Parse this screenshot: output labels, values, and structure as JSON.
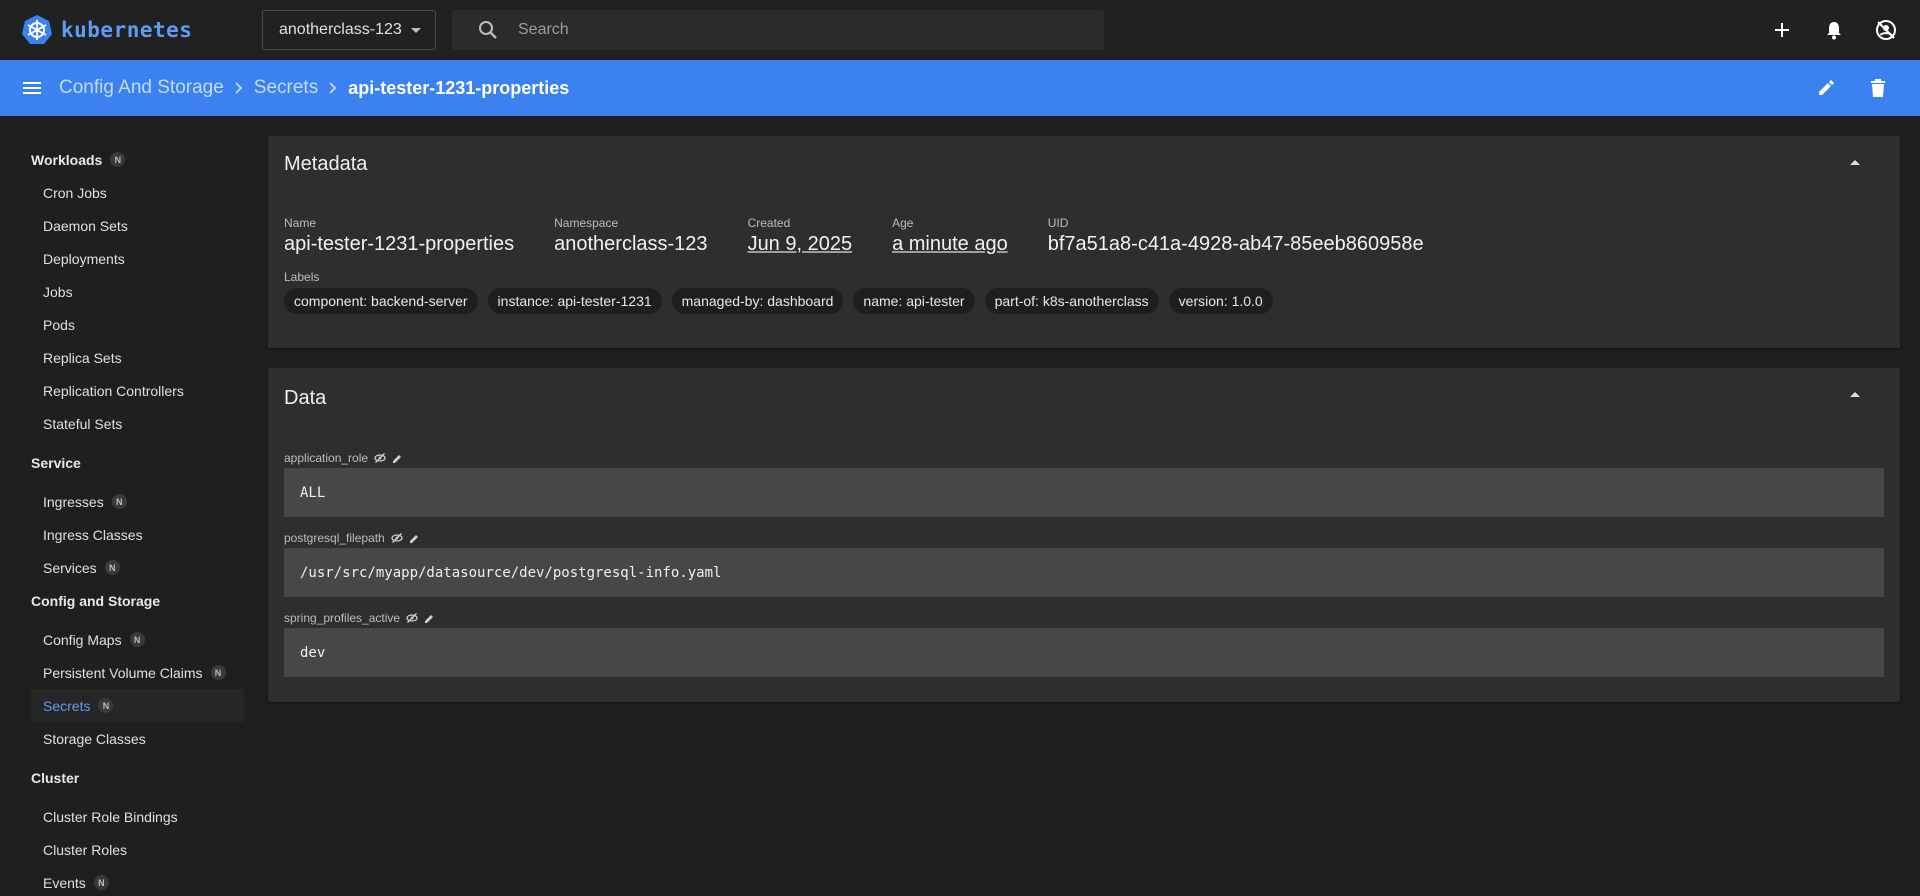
{
  "app": {
    "name": "kubernetes"
  },
  "topbar": {
    "namespace": "anotherclass-123",
    "search_placeholder": "Search"
  },
  "breadcrumb": {
    "items": [
      "Config And Storage",
      "Secrets"
    ],
    "current": "api-tester-1231-properties"
  },
  "sidebar": {
    "groups": [
      {
        "label": "Workloads",
        "badge": "N",
        "items": [
          {
            "label": "Cron Jobs"
          },
          {
            "label": "Daemon Sets"
          },
          {
            "label": "Deployments"
          },
          {
            "label": "Jobs"
          },
          {
            "label": "Pods"
          },
          {
            "label": "Replica Sets"
          },
          {
            "label": "Replication Controllers"
          },
          {
            "label": "Stateful Sets"
          }
        ]
      },
      {
        "label": "Service",
        "items": [
          {
            "label": "Ingresses",
            "badge": "N"
          },
          {
            "label": "Ingress Classes"
          },
          {
            "label": "Services",
            "badge": "N"
          }
        ]
      },
      {
        "label": "Config and Storage",
        "items": [
          {
            "label": "Config Maps",
            "badge": "N"
          },
          {
            "label": "Persistent Volume Claims",
            "badge": "N"
          },
          {
            "label": "Secrets",
            "badge": "N",
            "active": true
          },
          {
            "label": "Storage Classes"
          }
        ]
      },
      {
        "label": "Cluster",
        "items": [
          {
            "label": "Cluster Role Bindings"
          },
          {
            "label": "Cluster Roles"
          },
          {
            "label": "Events",
            "badge": "N"
          }
        ]
      }
    ]
  },
  "metadata": {
    "title": "Metadata",
    "fields": [
      {
        "key": "Name",
        "value": "api-tester-1231-properties"
      },
      {
        "key": "Namespace",
        "value": "anotherclass-123"
      },
      {
        "key": "Created",
        "value": "Jun 9, 2025"
      },
      {
        "key": "Age",
        "value": "a minute ago"
      },
      {
        "key": "UID",
        "value": "bf7a51a8-c41a-4928-ab47-85eeb860958e"
      }
    ],
    "labels_title": "Labels",
    "labels": [
      "component: backend-server",
      "instance: api-tester-1231",
      "managed-by: dashboard",
      "name: api-tester",
      "part-of: k8s-anotherclass",
      "version: 1.0.0"
    ]
  },
  "data_section": {
    "title": "Data",
    "entries": [
      {
        "key": "application_role",
        "value": "ALL"
      },
      {
        "key": "postgresql_filepath",
        "value": "/usr/src/myapp/datasource/dev/postgresql-info.yaml"
      },
      {
        "key": "spring_profiles_active",
        "value": "dev"
      }
    ]
  }
}
